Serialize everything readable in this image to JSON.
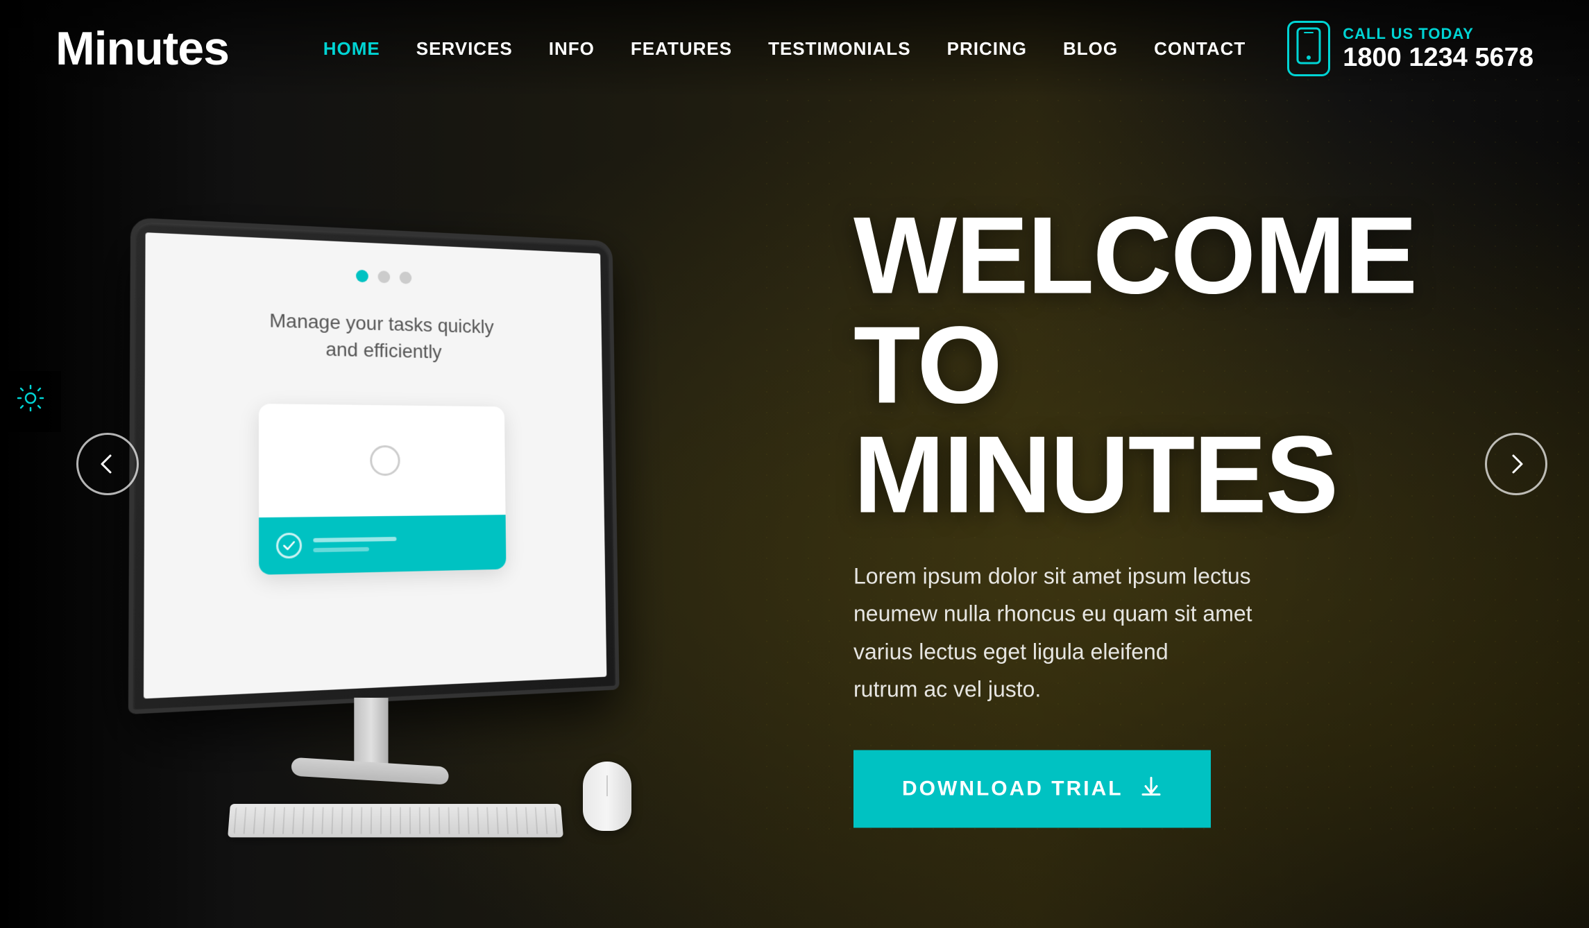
{
  "brand": {
    "logo": "Minutes"
  },
  "nav": {
    "links": [
      {
        "id": "home",
        "label": "HOME",
        "active": true
      },
      {
        "id": "services",
        "label": "SERVICES",
        "active": false
      },
      {
        "id": "info",
        "label": "INFO",
        "active": false
      },
      {
        "id": "features",
        "label": "FEATURES",
        "active": false
      },
      {
        "id": "testimonials",
        "label": "TESTIMONIALS",
        "active": false
      },
      {
        "id": "pricing",
        "label": "PRICING",
        "active": false
      },
      {
        "id": "blog",
        "label": "BLOG",
        "active": false
      },
      {
        "id": "contact",
        "label": "CONTACT",
        "active": false
      }
    ]
  },
  "call": {
    "label": "CALL US TODAY",
    "number": "1800 1234 5678"
  },
  "hero": {
    "title_line1": "WELCOME",
    "title_line2": "TO MINUTES",
    "description": "Lorem ipsum dolor sit amet ipsum lectus neumew nulla rhoncus eu quam sit amet varius lectus eget ligula eleifend\nrutrum ac vel justo.",
    "cta_label": "DOWNLOAD TRIAL"
  },
  "screen": {
    "text": "Manage your tasks quickly\nand efficiently"
  },
  "carousel": {
    "prev_label": "‹",
    "next_label": "›"
  },
  "settings": {
    "label": "⚙"
  }
}
